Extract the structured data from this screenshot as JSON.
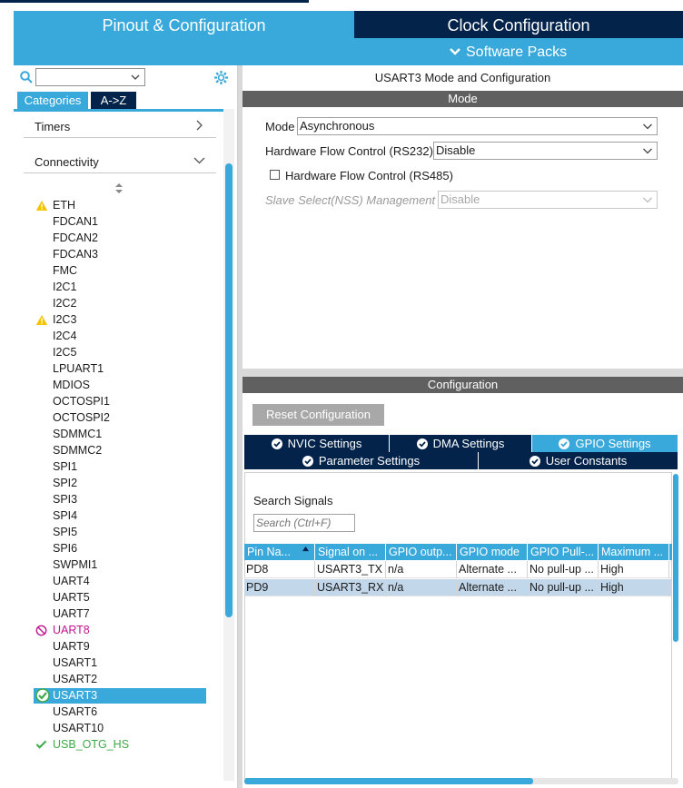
{
  "header": {
    "tab_pinout": "Pinout & Configuration",
    "tab_clock": "Clock Configuration",
    "software_packs": "Software Packs"
  },
  "sidebar": {
    "search_value": "",
    "tab_categories": "Categories",
    "tab_az": "A->Z",
    "groups": {
      "timers": "Timers",
      "connectivity": "Connectivity"
    },
    "items": [
      {
        "label": "ETH",
        "status": "warning"
      },
      {
        "label": "FDCAN1",
        "status": "none"
      },
      {
        "label": "FDCAN2",
        "status": "none"
      },
      {
        "label": "FDCAN3",
        "status": "none"
      },
      {
        "label": "FMC",
        "status": "none"
      },
      {
        "label": "I2C1",
        "status": "none"
      },
      {
        "label": "I2C2",
        "status": "none"
      },
      {
        "label": "I2C3",
        "status": "warning"
      },
      {
        "label": "I2C4",
        "status": "none"
      },
      {
        "label": "I2C5",
        "status": "none"
      },
      {
        "label": "LPUART1",
        "status": "none"
      },
      {
        "label": "MDIOS",
        "status": "none"
      },
      {
        "label": "OCTOSPI1",
        "status": "none"
      },
      {
        "label": "OCTOSPI2",
        "status": "none"
      },
      {
        "label": "SDMMC1",
        "status": "none"
      },
      {
        "label": "SDMMC2",
        "status": "none"
      },
      {
        "label": "SPI1",
        "status": "none"
      },
      {
        "label": "SPI2",
        "status": "none"
      },
      {
        "label": "SPI3",
        "status": "none"
      },
      {
        "label": "SPI4",
        "status": "none"
      },
      {
        "label": "SPI5",
        "status": "none"
      },
      {
        "label": "SPI6",
        "status": "none"
      },
      {
        "label": "SWPMI1",
        "status": "none"
      },
      {
        "label": "UART4",
        "status": "none"
      },
      {
        "label": "UART5",
        "status": "none"
      },
      {
        "label": "UART7",
        "status": "none"
      },
      {
        "label": "UART8",
        "status": "disabled"
      },
      {
        "label": "UART9",
        "status": "none"
      },
      {
        "label": "USART1",
        "status": "none"
      },
      {
        "label": "USART2",
        "status": "none"
      },
      {
        "label": "USART3",
        "status": "selected"
      },
      {
        "label": "USART6",
        "status": "none"
      },
      {
        "label": "USART10",
        "status": "none"
      },
      {
        "label": "USB_OTG_HS",
        "status": "ok"
      }
    ]
  },
  "main": {
    "title": "USART3 Mode and Configuration",
    "mode_header": "Mode",
    "mode": {
      "label": "Mode",
      "value": "Asynchronous"
    },
    "hwflow232": {
      "label": "Hardware Flow Control (RS232)",
      "value": "Disable"
    },
    "hwflow485": {
      "label": "Hardware Flow Control (RS485)",
      "checked": false
    },
    "nss": {
      "label": "Slave Select(NSS) Management",
      "value": "Disable"
    },
    "config_header": "Configuration",
    "reset_button": "Reset Configuration",
    "tabs": {
      "nvic": "NVIC Settings",
      "dma": "DMA Settings",
      "gpio": "GPIO Settings",
      "param": "Parameter Settings",
      "user": "User Constants"
    },
    "search_signals_label": "Search Signals",
    "search_placeholder": "Search (Ctrl+F)",
    "table": {
      "headers": [
        "Pin Na...",
        "Signal on ...",
        "GPIO outp...",
        "GPIO mode",
        "GPIO Pull-...",
        "Maximum ..."
      ],
      "rows": [
        [
          "PD8",
          "USART3_TX",
          "n/a",
          "Alternate ...",
          "No pull-up ...",
          "High"
        ],
        [
          "PD9",
          "USART3_RX",
          "n/a",
          "Alternate ...",
          "No pull-up ...",
          "High"
        ]
      ]
    }
  },
  "colors": {
    "accent": "#39a9dc",
    "dark": "#03234b",
    "warning": "#f5c400",
    "ok": "#3daa48",
    "disabled": "#c0158e",
    "selected_row": "#c3d7ea"
  }
}
